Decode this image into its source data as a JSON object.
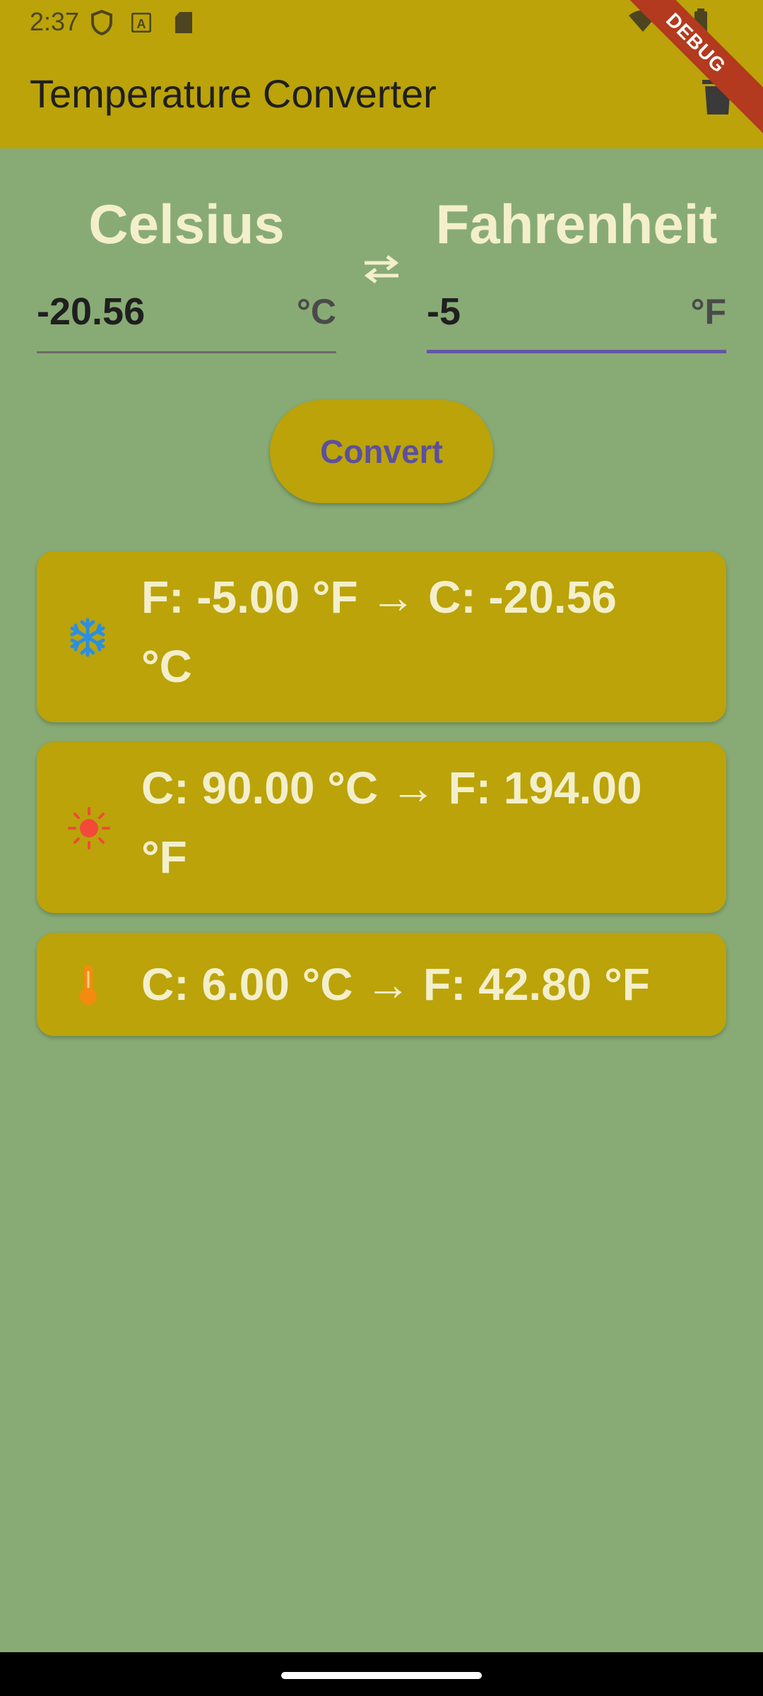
{
  "status_bar": {
    "time": "2:37"
  },
  "app_bar": {
    "title": "Temperature Converter",
    "debug_label": "DEBUG",
    "delete_icon": "trash-icon"
  },
  "converter": {
    "celsius": {
      "heading": "Celsius",
      "value": "-20.56",
      "unit": "°C"
    },
    "fahrenheit": {
      "heading": "Fahrenheit",
      "value": "-5",
      "unit": "°F"
    },
    "swap_icon": "swap-arrows-icon",
    "convert_label": "Convert"
  },
  "history": [
    {
      "icon": "snowflake-icon",
      "icon_color": "#2B8FE0",
      "line1": "F: -5.00 °F → C: -20.56",
      "line2": "°C"
    },
    {
      "icon": "sun-icon",
      "icon_color": "#F2493A",
      "line1": "C: 90.00 °C → F: 194.00",
      "line2": "°F"
    },
    {
      "icon": "thermometer-icon",
      "icon_color": "#F58A10",
      "line1": "C: 6.00 °C → F: 42.80 °F",
      "line2": ""
    }
  ],
  "colors": {
    "background": "#88AB75",
    "app_bar": "#BBA309",
    "accent": "#6655A8",
    "card_text": "#F3EFCB"
  }
}
